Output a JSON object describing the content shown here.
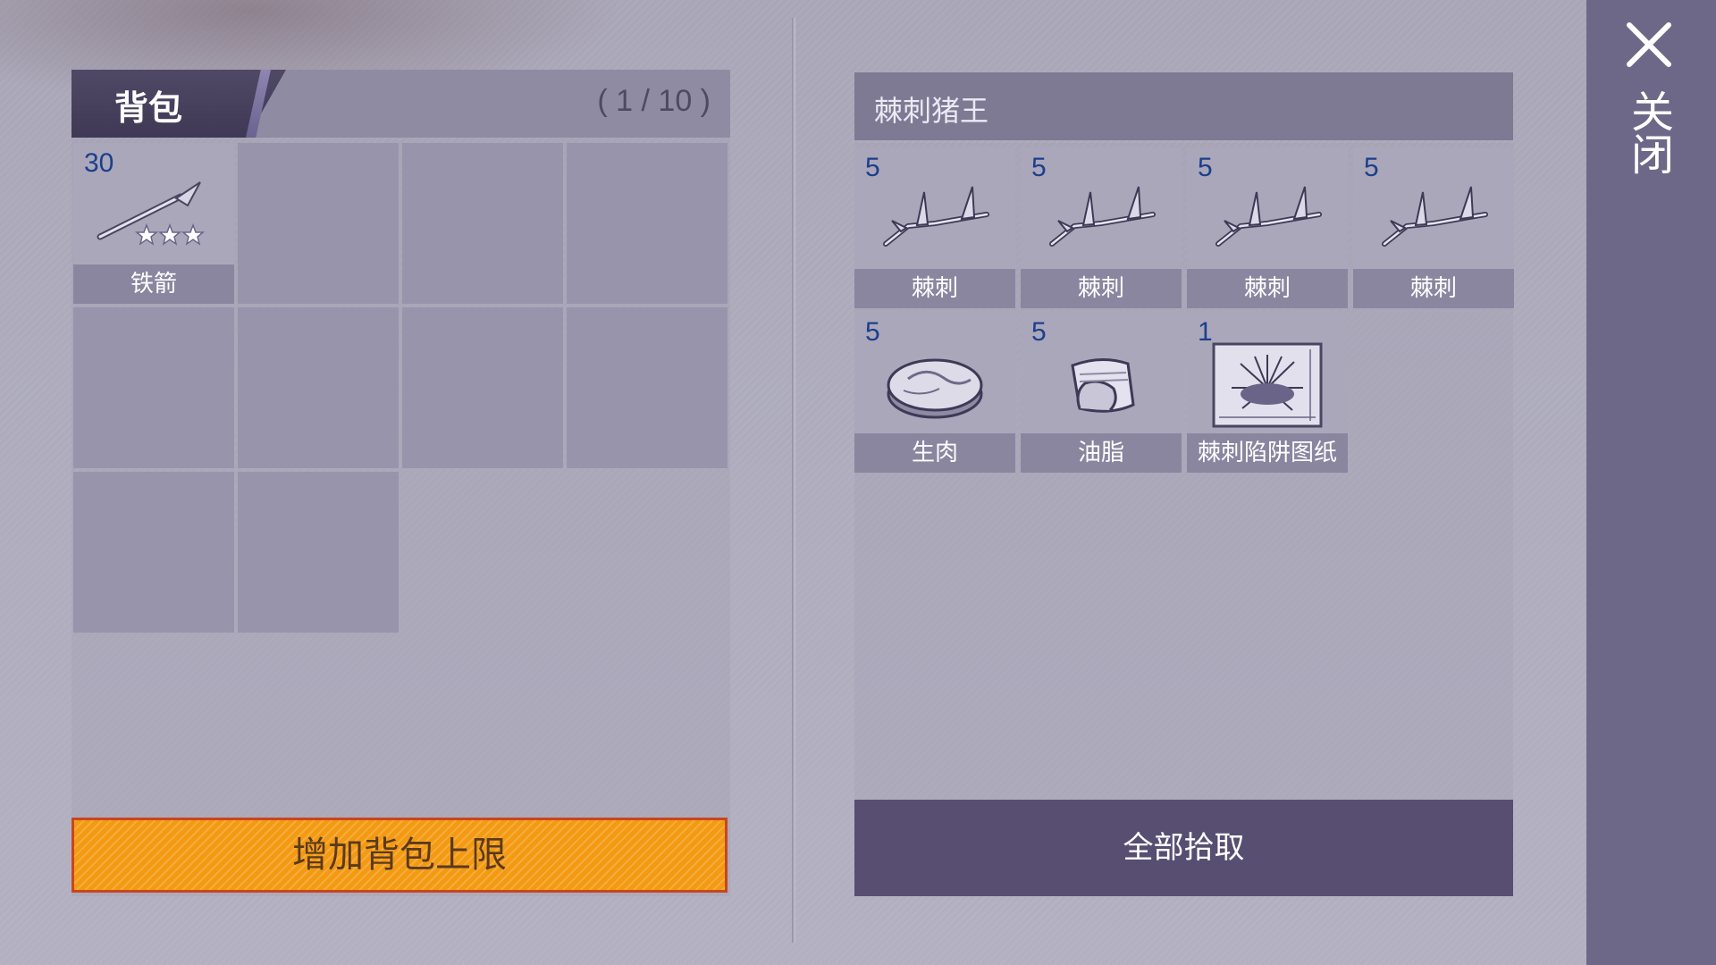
{
  "bag": {
    "title": "背包",
    "count": "( 1 / 10 )",
    "slots": [
      {
        "name": "铁箭",
        "qty": "30",
        "icon": "iron-arrow-icon",
        "stars": 3
      }
    ],
    "increase_label": "增加背包上限"
  },
  "loot": {
    "title": "棘刺猪王",
    "items": [
      {
        "name": "棘刺",
        "qty": "5",
        "icon": "thorn-icon"
      },
      {
        "name": "棘刺",
        "qty": "5",
        "icon": "thorn-icon"
      },
      {
        "name": "棘刺",
        "qty": "5",
        "icon": "thorn-icon"
      },
      {
        "name": "棘刺",
        "qty": "5",
        "icon": "thorn-icon"
      },
      {
        "name": "生肉",
        "qty": "5",
        "icon": "raw-meat-icon"
      },
      {
        "name": "油脂",
        "qty": "5",
        "icon": "grease-icon"
      },
      {
        "name": "棘刺陷阱图纸",
        "qty": "1",
        "icon": "blueprint-icon"
      }
    ],
    "pickup_all_label": "全部拾取"
  },
  "side": {
    "close_label": "关闭"
  },
  "colors": {
    "accent_orange": "#f39a12",
    "qty_blue": "#1c3f8a",
    "panel_dark": "#574e72"
  }
}
